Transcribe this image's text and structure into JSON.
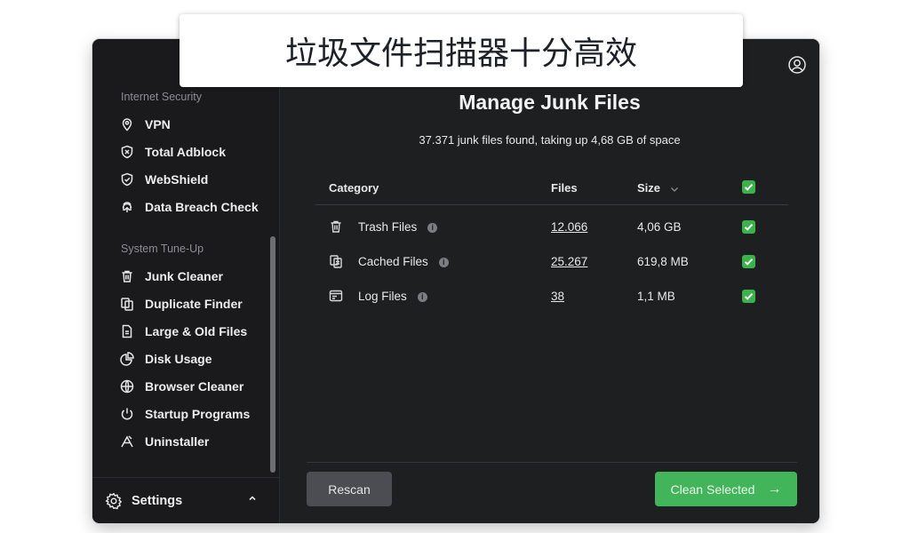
{
  "overlay": {
    "caption": "垃圾文件扫描器十分高效"
  },
  "sidebar": {
    "sections": [
      {
        "title": "Internet Security",
        "items": [
          {
            "label": "VPN",
            "icon": "location-pin-icon"
          },
          {
            "label": "Total Adblock",
            "icon": "shield-x-icon"
          },
          {
            "label": "WebShield",
            "icon": "shield-check-icon"
          },
          {
            "label": "Data Breach Check",
            "icon": "fingerprint-icon"
          }
        ]
      },
      {
        "title": "System Tune-Up",
        "items": [
          {
            "label": "Junk Cleaner",
            "icon": "trash-icon"
          },
          {
            "label": "Duplicate Finder",
            "icon": "duplicate-icon"
          },
          {
            "label": "Large & Old Files",
            "icon": "document-icon"
          },
          {
            "label": "Disk Usage",
            "icon": "pie-chart-icon"
          },
          {
            "label": "Browser Cleaner",
            "icon": "globe-icon"
          },
          {
            "label": "Startup Programs",
            "icon": "power-icon"
          },
          {
            "label": "Uninstaller",
            "icon": "uninstall-icon"
          }
        ]
      }
    ],
    "settings_label": "Settings"
  },
  "main": {
    "title": "Manage Junk Files",
    "subtitle": "37.371 junk files found, taking up 4,68 GB of space",
    "table": {
      "headers": {
        "category": "Category",
        "files": "Files",
        "size": "Size"
      },
      "rows": [
        {
          "category": "Trash Files",
          "files": "12.066",
          "size": "4,06 GB",
          "checked": true,
          "icon": "trash-icon"
        },
        {
          "category": "Cached Files",
          "files": "25.267",
          "size": "619,8 MB",
          "checked": true,
          "icon": "cache-icon"
        },
        {
          "category": "Log Files",
          "files": "38",
          "size": "1,1 MB",
          "checked": true,
          "icon": "log-icon"
        }
      ]
    },
    "buttons": {
      "rescan": "Rescan",
      "clean": "Clean Selected"
    }
  },
  "colors": {
    "accent": "#42b55a",
    "background": "#1e1f21",
    "sidebar": "#1a1a1c"
  }
}
